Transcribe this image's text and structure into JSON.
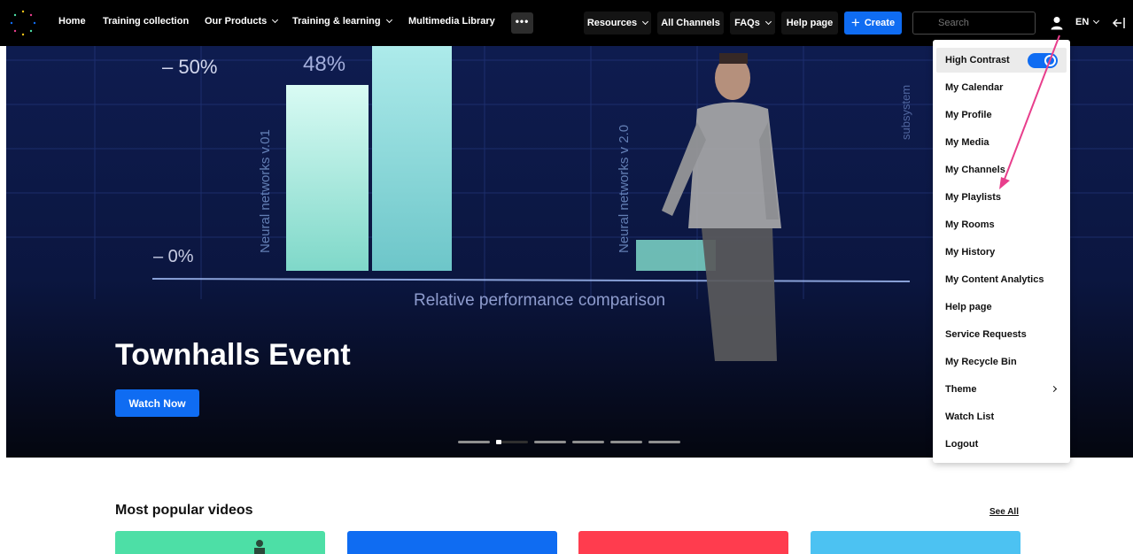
{
  "nav": {
    "home": "Home",
    "training_collection": "Training collection",
    "our_products": "Our Products",
    "training_learning": "Training & learning",
    "multimedia_library": "Multimedia Library",
    "more": "•••",
    "resources": "Resources",
    "all_channels": "All Channels",
    "faqs": "FAQs",
    "help_page": "Help page",
    "create": "Create",
    "search_placeholder": "Search",
    "language": "EN"
  },
  "hero": {
    "title": "Townhalls Event",
    "watch_label": "Watch Now",
    "screen_labels": {
      "minus50": "– 50%",
      "pct48": "48%",
      "zero": "– 0%",
      "nn1": "Neural networks v.01",
      "nn2": "Neural networks v 2.0",
      "subsystem": "subsystem",
      "caption": "Relative performance comparison"
    },
    "slide_count": 6,
    "active_slide": 2
  },
  "user_menu": {
    "items": [
      {
        "label": "High Contrast",
        "type": "toggle",
        "on": true
      },
      {
        "label": "My Calendar"
      },
      {
        "label": "My Profile"
      },
      {
        "label": "My Media"
      },
      {
        "label": "My Channels"
      },
      {
        "label": "My Playlists"
      },
      {
        "label": "My Rooms"
      },
      {
        "label": "My History"
      },
      {
        "label": "My Content Analytics"
      },
      {
        "label": "Help page"
      },
      {
        "label": "Service Requests"
      },
      {
        "label": "My Recycle Bin"
      },
      {
        "label": "Theme",
        "type": "submenu"
      },
      {
        "label": "Watch List"
      },
      {
        "label": "Logout"
      }
    ]
  },
  "popular": {
    "title": "Most popular videos",
    "see_all": "See All",
    "card_colors": [
      "#4ddfa6",
      "#0f6cf2",
      "#ff3c4e",
      "#4cc2f2"
    ]
  },
  "colors": {
    "accent": "#0f6cf2",
    "annotation": "#e83e8c",
    "nav_bg": "#000000"
  }
}
